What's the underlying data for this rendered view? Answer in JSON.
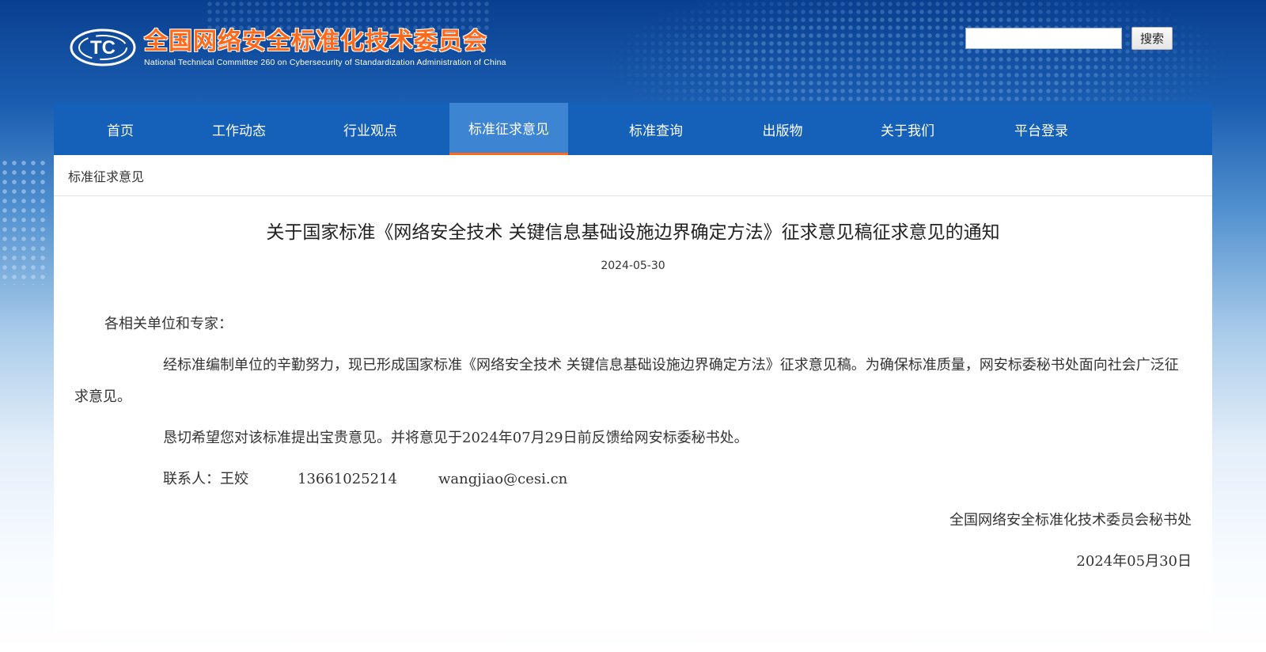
{
  "header": {
    "logo_mark": "TC",
    "title": "全国网络安全标准化技术委员会",
    "subtitle": "National Technical Committee 260 on Cybersecurity of Standardization Administration of China"
  },
  "search": {
    "value": "",
    "placeholder": "",
    "button_label": "搜索"
  },
  "nav": {
    "items": [
      {
        "label": "首页"
      },
      {
        "label": "工作动态"
      },
      {
        "label": "行业观点"
      },
      {
        "label": "标准征求意见"
      },
      {
        "label": "标准查询"
      },
      {
        "label": "出版物"
      },
      {
        "label": "关于我们"
      },
      {
        "label": "平台登录"
      }
    ],
    "active_index": 3
  },
  "breadcrumb": "标准征求意见",
  "article": {
    "title": "关于国家标准《网络安全技术 关键信息基础设施边界确定方法》征求意见稿征求意见的通知",
    "date": "2024-05-30",
    "greeting": "各相关单位和专家：",
    "paragraph1": "经标准编制单位的辛勤努力，现已形成国家标准《网络安全技术 关键信息基础设施边界确定方法》征求意见稿。为确保标准质量，网安标委秘书处面向社会广泛征求意见。",
    "paragraph2": "恳切希望您对该标准提出宝贵意见。并将意见于2024年07月29日前反馈给网安标委秘书处。",
    "contact": {
      "label": "联系人：王姣",
      "phone": "13661025214",
      "email": "wangjiao@cesi.cn"
    },
    "signature": "全国网络安全标准化技术委员会秘书处",
    "signature_date": "2024年05月30日"
  },
  "colors": {
    "nav_bg": "#1560b8",
    "nav_active_bg": "#3d85d2",
    "accent_orange": "#ff6a1a"
  }
}
